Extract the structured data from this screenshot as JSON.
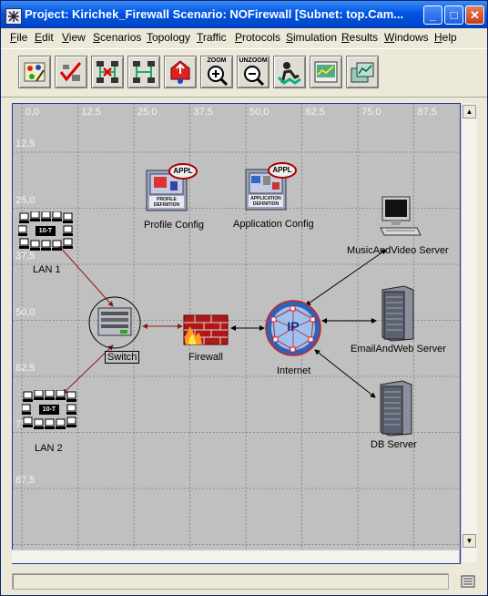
{
  "window": {
    "title": "Project: Kirichek_Firewall Scenario: NOFirewall  [Subnet: top.Cam...",
    "minimize": "_",
    "maximize": "□",
    "close": "✕"
  },
  "menu": [
    {
      "label": "File",
      "key": "F",
      "rest": "ile"
    },
    {
      "label": "Edit",
      "key": "E",
      "rest": "dit"
    },
    {
      "label": "View",
      "key": "V",
      "rest": "iew"
    },
    {
      "label": "Scenarios",
      "key": "S",
      "rest": "cenarios"
    },
    {
      "label": "Topology",
      "key": "T",
      "rest": "opology"
    },
    {
      "label": "Traffic",
      "key": "T",
      "rest": "raffic"
    },
    {
      "label": "Protocols",
      "key": "P",
      "rest": "rotocols"
    },
    {
      "label": "Simulation",
      "key": "S",
      "rest": "imulation"
    },
    {
      "label": "Results",
      "key": "R",
      "rest": "esults"
    },
    {
      "label": "Windows",
      "key": "W",
      "rest": "indows"
    },
    {
      "label": "Help",
      "key": "H",
      "rest": "elp"
    }
  ],
  "toolbar": {
    "buttons": [
      "object-palette-icon",
      "check-links-icon",
      "fail-link-icon",
      "recover-link-icon",
      "return-to-parent-icon",
      "zoom-icon",
      "unzoom-icon",
      "configure-simulation-icon",
      "view-results-icon",
      "hide-graphs-icon"
    ],
    "zoom_label": "ZOOM",
    "unzoom_label": "UNZOOM"
  },
  "grid": {
    "x_ticks": [
      "0,0",
      "12,5",
      "25,0",
      "37,5",
      "50,0",
      "62,5",
      "75,0",
      "87,5"
    ],
    "y_ticks": [
      "12,5",
      "25,0",
      "37,5",
      "50,0",
      "62,5",
      "75,0",
      "87,5"
    ]
  },
  "nodes": {
    "profile_config": {
      "label": "Profile Config",
      "badge": "APPL",
      "caption": "PROFILE DEFINITION"
    },
    "application_config": {
      "label": "Application Config",
      "badge": "APPL",
      "caption": "APPLICATION DEFINITION"
    },
    "lan1": {
      "label": "LAN 1",
      "badge": "10-T"
    },
    "lan2": {
      "label": "LAN 2",
      "badge": "10-T"
    },
    "switch": {
      "label": "Switch"
    },
    "firewall": {
      "label": "Firewall"
    },
    "internet": {
      "label": "Internet",
      "badge": "IP"
    },
    "music_video_server": {
      "label": "MusicAndVideo Server"
    },
    "email_web_server": {
      "label": "EmailAndWeb Server"
    },
    "db_server": {
      "label": "DB Server"
    }
  },
  "colors": {
    "grid_line": "#8c8c8c",
    "canvas_bg": "#c0c0c0",
    "link_dark_red": "#8b1a1a",
    "link_black": "#000000",
    "title_blue": "#0054e3"
  }
}
